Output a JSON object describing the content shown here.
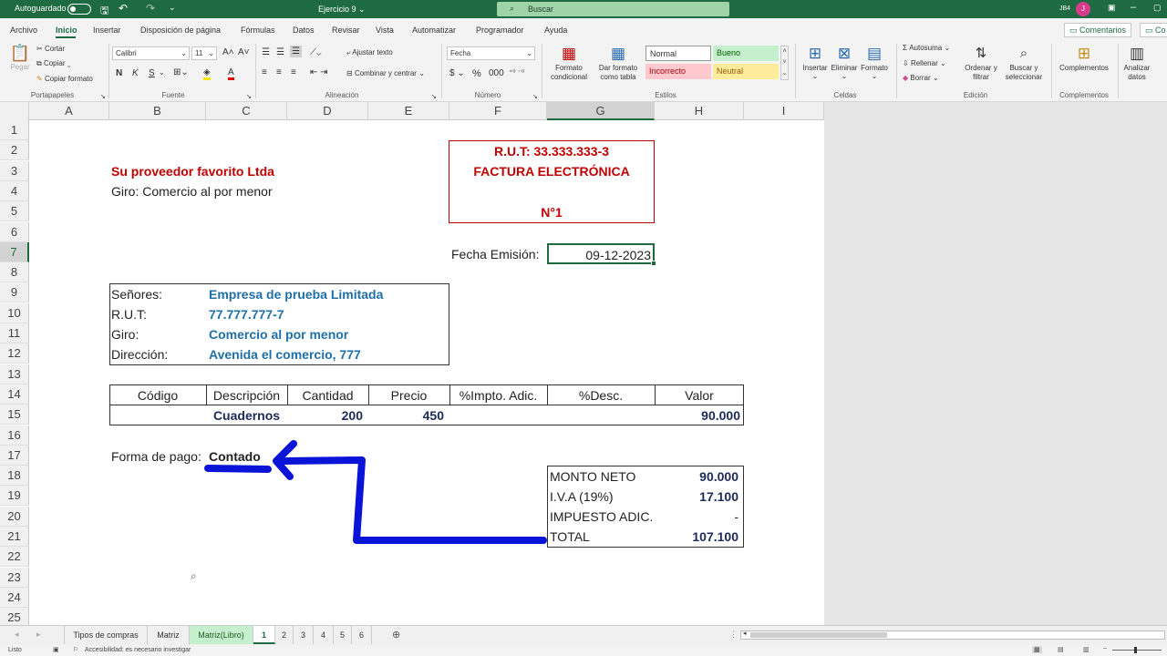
{
  "titlebar": {
    "autosave_label": "Autoguardado",
    "doc_title": "Ejercicio 9 ⌄",
    "search_placeholder": "Buscar",
    "user_initials": "JB4",
    "avatar_letter": "J"
  },
  "menu": {
    "tabs": [
      "Archivo",
      "Inicio",
      "Insertar",
      "Disposición de página",
      "Fórmulas",
      "Datos",
      "Revisar",
      "Vista",
      "Automatizar",
      "Programador",
      "Ayuda"
    ],
    "active": "Inicio",
    "comments_label": "Comentarios",
    "share_label": "Co"
  },
  "ribbon": {
    "paste": "Pegar",
    "cut": "Cortar",
    "copy": "Copiar",
    "copy_format": "Copiar formato",
    "font_name": "Calibri",
    "font_size": "11",
    "bold": "N",
    "italic": "K",
    "underline": "S",
    "wrap": "Ajustar texto",
    "merge": "Combinar y centrar",
    "number_format": "Fecha",
    "cond_format": "Formato condicional",
    "table_format": "Dar formato como tabla",
    "styles": {
      "normal": "Normal",
      "bueno": "Bueno",
      "incorrecto": "Incorrecto",
      "neutral": "Neutral"
    },
    "insert": "Insertar",
    "delete": "Eliminar",
    "format": "Formato",
    "autosum": "Autosuma",
    "fill": "Rellenar",
    "clear": "Borrar",
    "sort": "Ordenar y filtrar",
    "find": "Buscar y seleccionar",
    "addins": "Complementos",
    "analyze": "Analizar datos",
    "groups": {
      "clipboard": "Portapapeles",
      "font": "Fuente",
      "alignment": "Alineación",
      "number": "Número",
      "styles": "Estilos",
      "cells": "Celdas",
      "editing": "Edición",
      "addins": "Complementos"
    }
  },
  "columns": [
    "A",
    "B",
    "C",
    "D",
    "E",
    "F",
    "G",
    "H",
    "I"
  ],
  "rows": [
    "1",
    "2",
    "3",
    "4",
    "5",
    "6",
    "7",
    "8",
    "9",
    "10",
    "11",
    "12",
    "13",
    "14",
    "15",
    "16",
    "17",
    "18",
    "19",
    "20",
    "21",
    "22",
    "23",
    "24",
    "25"
  ],
  "sheet": {
    "company": "Su proveedor favorito Ltda",
    "giro_header": "Giro: Comercio al por menor",
    "rut_header": "R.U.T: 33.333.333-3",
    "invoice_title": "FACTURA ELECTRÓNICA",
    "invoice_number": "N°1",
    "date_label": "Fecha Emisión:",
    "date_value": "09-12-2023",
    "client": {
      "senores_label": "Señores:",
      "senores_value": "Empresa de prueba Limitada",
      "rut_label": "R.U.T:",
      "rut_value": "77.777.777-7",
      "giro_label": "Giro:",
      "giro_value": "Comercio al por menor",
      "dir_label": "Dirección:",
      "dir_value": "Avenida el comercio, 777"
    },
    "items_headers": [
      "Código",
      "Descripción",
      "Cantidad",
      "Precio",
      "%Impto. Adic.",
      "%Desc.",
      "Valor"
    ],
    "item": {
      "codigo": "",
      "descripcion": "Cuadernos",
      "cantidad": "200",
      "precio": "450",
      "impto": "",
      "desc": "",
      "valor": "90.000"
    },
    "payment_label": "Forma de pago:",
    "payment_value": "Contado",
    "totals": {
      "neto_label": "MONTO NETO",
      "neto_value": "90.000",
      "iva_label": "I.V.A (19%)",
      "iva_value": "17.100",
      "adic_label": "IMPUESTO ADIC.",
      "adic_value": "-",
      "total_label": "TOTAL",
      "total_value": "107.100"
    }
  },
  "sheet_tabs": [
    "Tipos de compras",
    "Matriz",
    "Matriz(Libro)",
    "1",
    "2",
    "3",
    "4",
    "5",
    "6"
  ],
  "active_sheet_tab": "1",
  "status": {
    "ready": "Listo",
    "accessibility": "Accesibilidad: es necesario investigar"
  },
  "colors": {
    "excel_green": "#1e6b41",
    "red": "#c00000",
    "blue": "#1f6fa8",
    "arrow": "#0a14d8"
  }
}
